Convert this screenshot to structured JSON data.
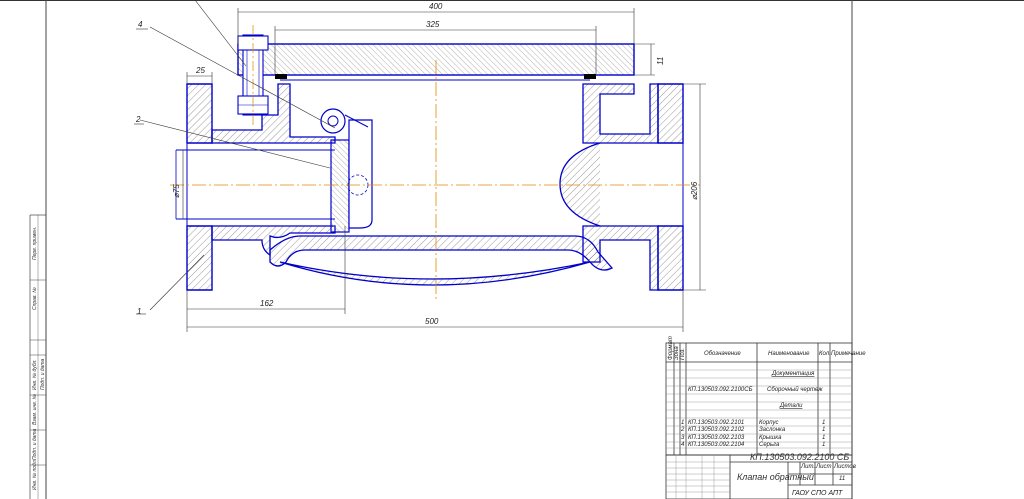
{
  "dimensions": {
    "overall_top": "400",
    "cover_length": "325",
    "flange_width": "25",
    "cover_thickness": "11",
    "bore_diameter": "⌀75",
    "flange_diameter": "⌀206",
    "flange_to_axis": "162",
    "overall_length": "500"
  },
  "callouts": [
    "1",
    "2",
    "4"
  ],
  "spec_table": {
    "headers": [
      "Формат",
      "Зона",
      "Поз.",
      "Обозначение",
      "Наименование",
      "Кол.",
      "Примечание"
    ],
    "section_documentation": "Документация",
    "doc_row": {
      "designation": "КП.130503.092.2100СБ",
      "name": "Сборочный чертеж"
    },
    "section_parts": "Детали",
    "parts": [
      {
        "pos": "1",
        "designation": "КП.130503.092.2101",
        "name": "Корпус",
        "qty": "1"
      },
      {
        "pos": "2",
        "designation": "КП.130503.092.2102",
        "name": "Заслонка",
        "qty": "1"
      },
      {
        "pos": "3",
        "designation": "КП.130503.092.2103",
        "name": "Крышка",
        "qty": "1"
      },
      {
        "pos": "4",
        "designation": "КП.130503.092.2104",
        "name": "Серьга",
        "qty": "1"
      }
    ]
  },
  "title_block": {
    "document_code": "КП.130503.092.2100 СБ",
    "product_name": "Клапан обратный",
    "sheet_label": "Лист",
    "sheets_label": "Листов",
    "sheets_count": "11",
    "organization": "ГАОУ СПО АПТ",
    "stage_label": "Лит."
  },
  "side_stamps": [
    "Инв. № подл.",
    "Подп. и дата",
    "Взам. инв. №",
    "Инв. № дубл.",
    "Подп. и дата",
    "Справ. №",
    "Перв. примен."
  ],
  "colors": {
    "outline": "#0000cc",
    "centerline": "#e08a00",
    "dimension": "#333333",
    "hatch": "#555555"
  }
}
